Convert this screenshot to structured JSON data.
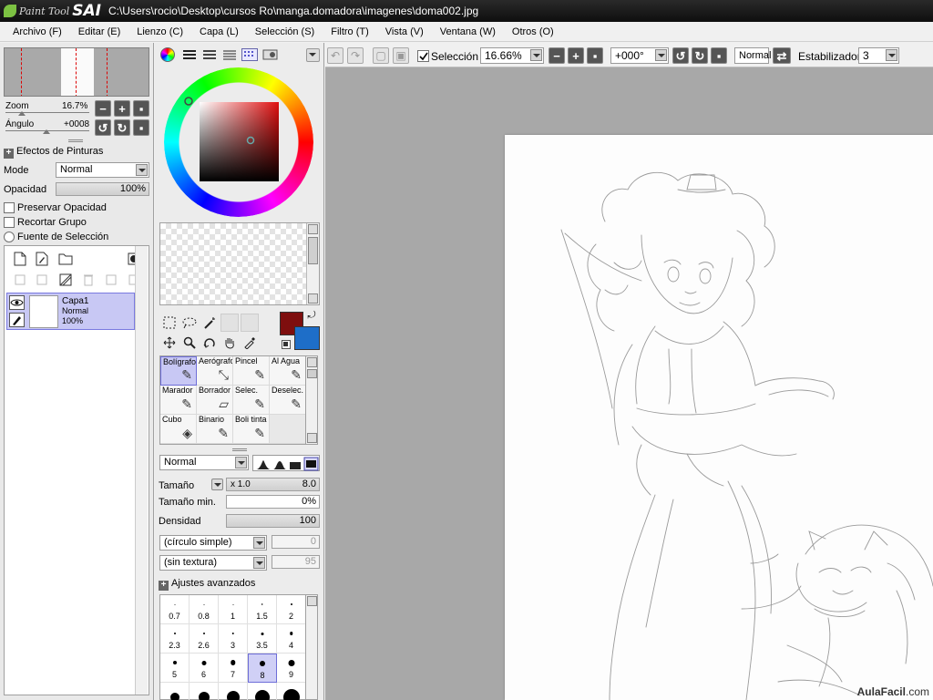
{
  "window": {
    "app_logo_top": "Paint Tool",
    "app_logo_main": "SAI",
    "document_path": "C:\\Users\\rocio\\Desktop\\cursos Ro\\manga.domadora\\imagenes\\doma002.jpg"
  },
  "menu": [
    "Archivo (F)",
    "Editar (E)",
    "Lienzo (C)",
    "Capa (L)",
    "Selección (S)",
    "Filtro (T)",
    "Vista (V)",
    "Ventana (W)",
    "Otros (O)"
  ],
  "navigator": {
    "zoom_label": "Zoom",
    "zoom_value": "16.7%",
    "angle_label": "Ángulo",
    "angle_value": "+0008"
  },
  "layer_props": {
    "effects_label": "Efectos de Pinturas",
    "mode_label": "Mode",
    "mode_value": "Normal",
    "opacity_label": "Opacidad",
    "opacity_value": "100%",
    "preserve_opacity_label": "Preservar Opacidad",
    "clip_group_label": "Recortar Grupo",
    "selection_source_label": "Fuente de Selección"
  },
  "layer": {
    "name": "Capa1",
    "mode": "Normal",
    "opacity": "100%"
  },
  "brushes": [
    {
      "label": "Bolígrafo",
      "icon": "pen-icon",
      "glyph": "✒"
    },
    {
      "label": "Aerógrafo",
      "icon": "airbrush-icon",
      "glyph": "✈"
    },
    {
      "label": "Pincel",
      "icon": "brush-icon",
      "glyph": "🖌"
    },
    {
      "label": "Al Agua",
      "icon": "water-brush-icon",
      "glyph": "💧"
    },
    {
      "label": "Marador",
      "icon": "marker-icon",
      "glyph": "✎"
    },
    {
      "label": "Borrador",
      "icon": "eraser-icon",
      "glyph": "▱"
    },
    {
      "label": "Selec.",
      "icon": "select-pen-icon",
      "glyph": "✎"
    },
    {
      "label": "Deselec.",
      "icon": "deselect-pen-icon",
      "glyph": "✎"
    },
    {
      "label": "Cubo",
      "icon": "bucket-icon",
      "glyph": "◈"
    },
    {
      "label": "Binario",
      "icon": "binary-pen-icon",
      "glyph": "✎"
    },
    {
      "label": "Boli tinta",
      "icon": "ink-pen-icon",
      "glyph": "✎"
    }
  ],
  "brush_settings": {
    "blend_mode": "Normal",
    "size_label": "Tamaño",
    "size_multiplier": "x 1.0",
    "size_value": "8.0",
    "min_size_label": "Tamaño min.",
    "min_size_value": "0%",
    "density_label": "Densidad",
    "density_value": "100",
    "shape": "(círculo simple)",
    "shape_value": "0",
    "texture": "(sin textura)",
    "texture_value": "95",
    "advanced_label": "Ajustes avanzados"
  },
  "brush_sizes": [
    {
      "label": "0.7",
      "size": 1
    },
    {
      "label": "0.8",
      "size": 1
    },
    {
      "label": "1",
      "size": 1
    },
    {
      "label": "1.5",
      "size": 1.5
    },
    {
      "label": "2",
      "size": 2
    },
    {
      "label": "2.3",
      "size": 2
    },
    {
      "label": "2.6",
      "size": 2
    },
    {
      "label": "3",
      "size": 2.5
    },
    {
      "label": "3.5",
      "size": 3
    },
    {
      "label": "4",
      "size": 3.5
    },
    {
      "label": "5",
      "size": 4
    },
    {
      "label": "6",
      "size": 5
    },
    {
      "label": "7",
      "size": 5.5
    },
    {
      "label": "8",
      "size": 6
    },
    {
      "label": "9",
      "size": 7
    },
    {
      "label": "",
      "size": 10
    },
    {
      "label": "",
      "size": 12
    },
    {
      "label": "",
      "size": 14
    },
    {
      "label": "",
      "size": 16
    },
    {
      "label": "",
      "size": 18
    }
  ],
  "brush_size_selected": "8",
  "toolbar": {
    "selection_label": "Selección",
    "zoom_value": "16.66%",
    "rotation_value": "+000°",
    "mode_value": "Normal",
    "stabilizer_label": "Estabilizador",
    "stabilizer_value": "3"
  },
  "colors": {
    "foreground": "#7e0e0e",
    "background": "#1e6ec8",
    "selection_accent": "#c8c8f4"
  },
  "watermark": {
    "brand": "AulaFacil",
    "domain": ".com"
  }
}
